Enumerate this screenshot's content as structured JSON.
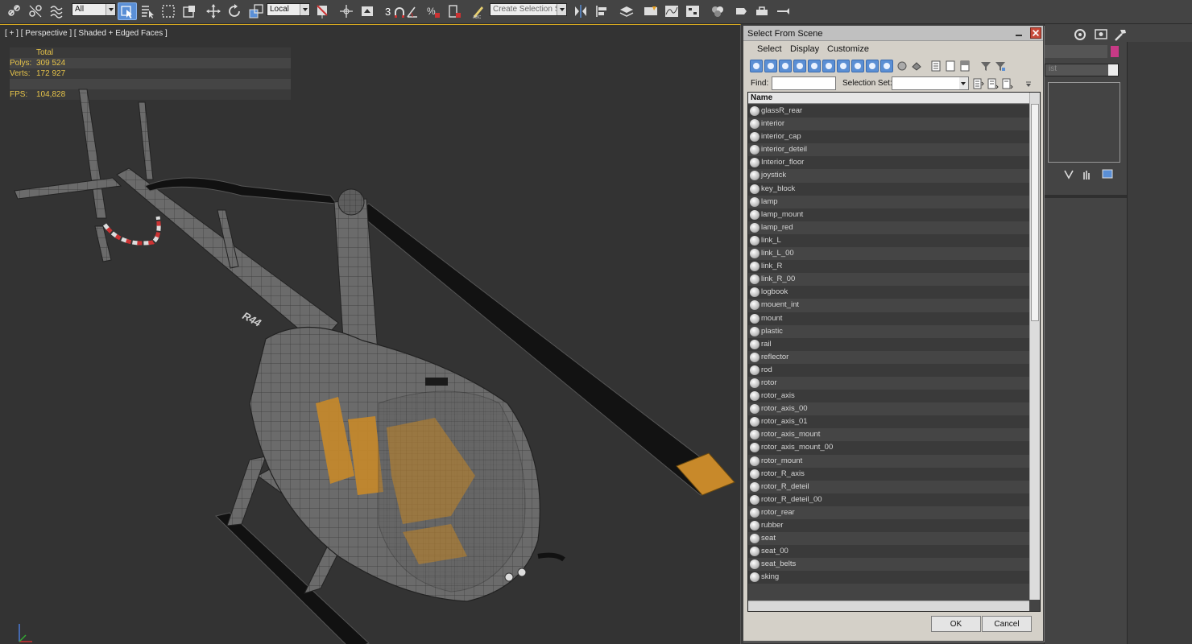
{
  "toolbar": {
    "selection_filter": "All",
    "coord_system": "Local",
    "snap_number": "3",
    "named_selection_placeholder": "Create Selection Se"
  },
  "viewport": {
    "label": "[ + ] [ Perspective ] [ Shaded + Edged Faces ]",
    "stats": {
      "total_label": "Total",
      "polys_label": "Polys:",
      "polys_value": "309 524",
      "verts_label": "Verts:",
      "verts_value": "172 927",
      "fps_label": "FPS:",
      "fps_value": "104,828"
    },
    "model_label": "R44"
  },
  "dialog": {
    "title": "Select From Scene",
    "menu": [
      "Select",
      "Display",
      "Customize"
    ],
    "find_label": "Find:",
    "find_value": "",
    "selection_set_label": "Selection Set:",
    "selection_set_value": "",
    "column_header": "Name",
    "items": [
      "glassR_rear",
      "interior",
      "interior_cap",
      "interior_deteil",
      "Interior_floor",
      "joystick",
      "key_block",
      "lamp",
      "lamp_mount",
      "lamp_red",
      "link_L",
      "link_L_00",
      "link_R",
      "link_R_00",
      "logbook",
      "mouent_int",
      "mount",
      "plastic",
      "rail",
      "reflector",
      "rod",
      "rotor",
      "rotor_axis",
      "rotor_axis_00",
      "rotor_axis_01",
      "rotor_axis_mount",
      "rotor_axis_mount_00",
      "rotor_mount",
      "rotor_R_axis",
      "rotor_R_deteil",
      "rotor_R_deteil_00",
      "rotor_rear",
      "rubber",
      "seat",
      "seat_00",
      "seat_belts",
      "sking"
    ],
    "ok_label": "OK",
    "cancel_label": "Cancel"
  },
  "command_panel": {
    "dropdown_text": "ist",
    "accent_color": "#c73a86"
  },
  "colors": {
    "viewport_bg": "#333333",
    "stats_text": "#e7c44a",
    "active_tool": "#5a8fd6",
    "interior_orange": "#c8892a"
  }
}
